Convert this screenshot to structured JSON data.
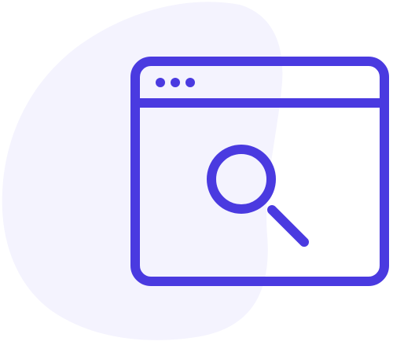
{
  "illustration": {
    "subject": "browser-window-search",
    "icons": [
      "browser-window-icon",
      "magnifying-glass-icon"
    ],
    "window_control_dots": 3
  },
  "colors": {
    "background": "#ffffff",
    "blob": "#f4f3fe",
    "stroke": "#4a3ae0"
  }
}
